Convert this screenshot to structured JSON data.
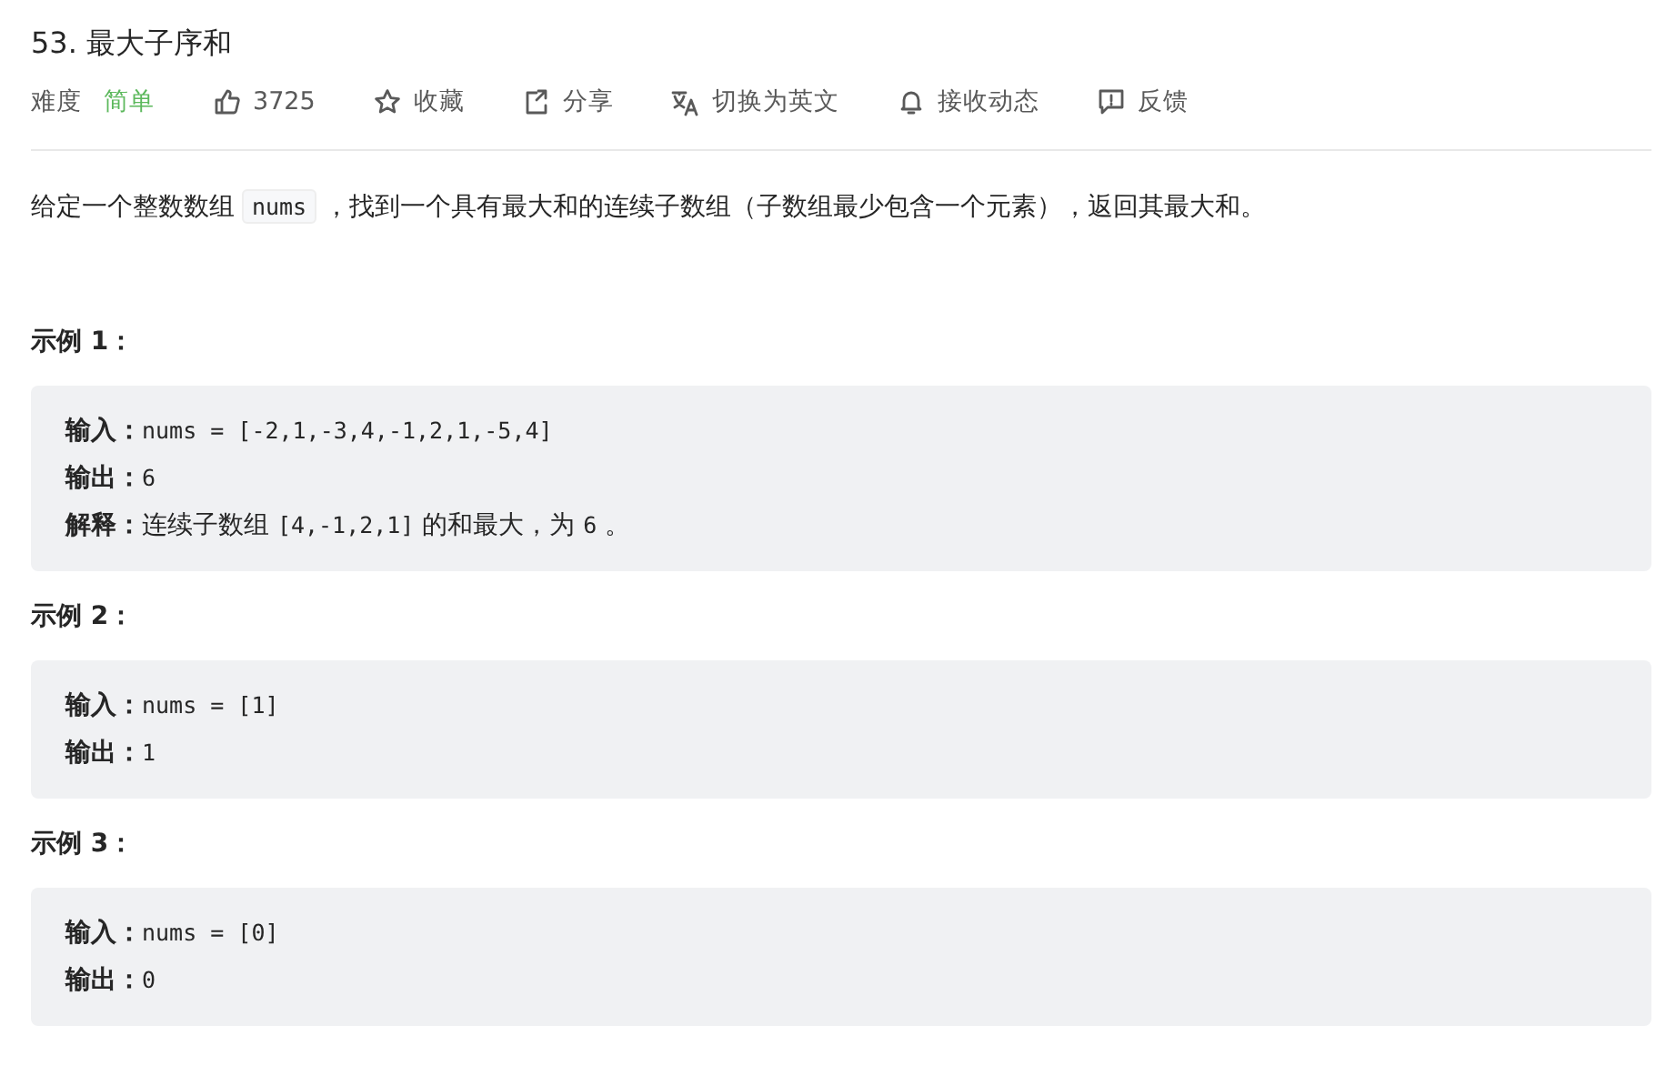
{
  "title": "53. 最大子序和",
  "difficulty": {
    "label": "难度",
    "value": "简单"
  },
  "actions": [
    {
      "kind": "like",
      "label": "3725"
    },
    {
      "kind": "star",
      "label": "收藏"
    },
    {
      "kind": "share",
      "label": "分享"
    },
    {
      "kind": "translate",
      "label": "切换为英文"
    },
    {
      "kind": "bell",
      "label": "接收动态"
    },
    {
      "kind": "feedback",
      "label": "反馈"
    }
  ],
  "description": [
    {
      "kind": "text",
      "text": "给定一个整数数组 "
    },
    {
      "kind": "code",
      "text": "nums"
    },
    {
      "kind": "text",
      "text": " ，找到一个具有最大和的连续子数组（子数组最少包含一个元素），返回其最大和。"
    }
  ],
  "examples": [
    {
      "heading": "示例 1：",
      "lines": [
        {
          "label": "输入：",
          "parts": [
            {
              "kind": "code",
              "text": "nums = [-2,1,-3,4,-1,2,1,-5,4]"
            }
          ]
        },
        {
          "label": "输出：",
          "parts": [
            {
              "kind": "code",
              "text": "6"
            }
          ]
        },
        {
          "label": "解释：",
          "parts": [
            {
              "kind": "text",
              "text": "连续子数组 "
            },
            {
              "kind": "code",
              "text": "[4,-1,2,1]"
            },
            {
              "kind": "text",
              "text": " 的和最大，为 "
            },
            {
              "kind": "code",
              "text": "6"
            },
            {
              "kind": "text",
              "text": " 。"
            }
          ]
        }
      ]
    },
    {
      "heading": "示例 2：",
      "lines": [
        {
          "label": "输入：",
          "parts": [
            {
              "kind": "code",
              "text": "nums = [1]"
            }
          ]
        },
        {
          "label": "输出：",
          "parts": [
            {
              "kind": "code",
              "text": "1"
            }
          ]
        }
      ]
    },
    {
      "heading": "示例 3：",
      "lines": [
        {
          "label": "输入：",
          "parts": [
            {
              "kind": "code",
              "text": "nums = [0]"
            }
          ]
        },
        {
          "label": "输出：",
          "parts": [
            {
              "kind": "code",
              "text": "0"
            }
          ]
        }
      ]
    }
  ]
}
